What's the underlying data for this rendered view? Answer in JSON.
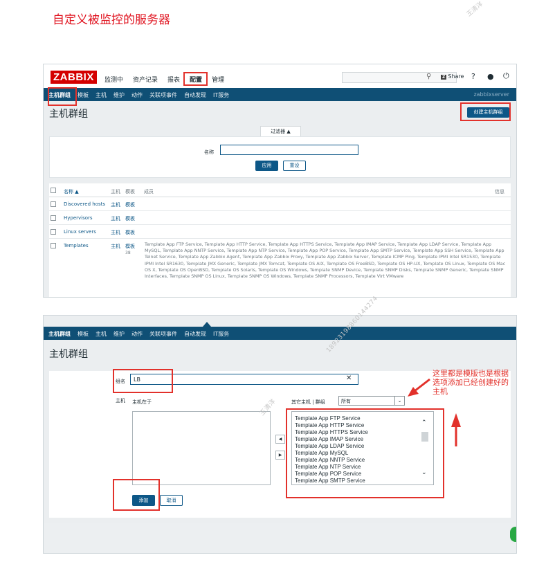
{
  "doc": {
    "title": "自定义被监控的服务器",
    "watermark_name": "王清洋",
    "watermark_phone": "18923198860144274"
  },
  "zabbix": {
    "logo": "ZABBIX",
    "main_menu": [
      "监测中",
      "资产记录",
      "报表",
      "配置",
      "管理"
    ],
    "active_main": "配置",
    "share_label": "Share",
    "help_glyph": "?",
    "user_glyph": "●",
    "power_glyph": "⏻",
    "sub_menu": [
      "主机群组",
      "模板",
      "主机",
      "维护",
      "动作",
      "关联项事件",
      "自动发现",
      "IT服务"
    ],
    "username": "zabbixserver"
  },
  "shot1": {
    "heading": "主机群组",
    "create_button": "创建主机群组",
    "filter": {
      "tab_label": "过滤器 ▲",
      "name_label": "名称",
      "apply": "应用",
      "reset": "重设"
    },
    "table": {
      "headers": {
        "name": "名称 ▲",
        "hosts": "主机",
        "templates": "模板",
        "members": "成员",
        "info": "信息"
      },
      "rows": [
        {
          "name": "Discovered hosts",
          "hosts": "主机",
          "templates": "模板",
          "template_count": "",
          "members": ""
        },
        {
          "name": "Hypervisors",
          "hosts": "主机",
          "templates": "模板",
          "template_count": "",
          "members": ""
        },
        {
          "name": "Linux servers",
          "hosts": "主机",
          "templates": "模板",
          "template_count": "",
          "members": ""
        },
        {
          "name": "Templates",
          "hosts": "主机",
          "templates": "模板",
          "template_count": "38",
          "members": "Template App FTP Service, Template App HTTP Service, Template App HTTPS Service, Template App IMAP Service, Template App LDAP Service, Template App MySQL, Template App NNTP Service, Template App NTP Service, Template App POP Service, Template App SMTP Service, Template App SSH Service, Template App Telnet Service, Template App Zabbix Agent, Template App Zabbix Proxy, Template App Zabbix Server, Template ICMP Ping, Template IPMI Intel SR1530, Template IPMI Intel SR1630, Template JMX Generic, Template JMX Tomcat, Template OS AIX, Template OS FreeBSD, Template OS HP-UX, Template OS Linux, Template OS Mac OS X, Template OS OpenBSD, Template OS Solaris, Template OS Windows, Template SNMP Device, Template SNMP Disks, Template SNMP Generic, Template SNMP Interfaces, Template SNMP OS Linux, Template SNMP OS Windows, Template SNMP Processors, Template Virt VMware"
        }
      ]
    }
  },
  "shot2": {
    "heading": "主机群组",
    "form": {
      "group_name_label": "组名",
      "group_name_value": "LB",
      "clear_glyph": "✕",
      "hosts_label": "主机",
      "in_group_label": "主机在于",
      "other_label": "其它主机 | 群组",
      "group_select": "所有",
      "move_left": "◀",
      "move_right": "▶",
      "other_hosts": [
        "Template App FTP Service",
        "Template App HTTP Service",
        "Template App HTTPS Service",
        "Template App IMAP Service",
        "Template App LDAP Service",
        "Template App MySQL",
        "Template App NNTP Service",
        "Template App NTP Service",
        "Template App POP Service",
        "Template App SMTP Service"
      ],
      "add": "添加",
      "cancel": "取消"
    }
  },
  "annotation": {
    "note": "这里都是模版也是根据选项添加已经创建好的主机"
  },
  "colors": {
    "nav": "#0f4f75",
    "primary": "#0d5787",
    "highlight": "#e2312b",
    "logo": "#d40000"
  }
}
